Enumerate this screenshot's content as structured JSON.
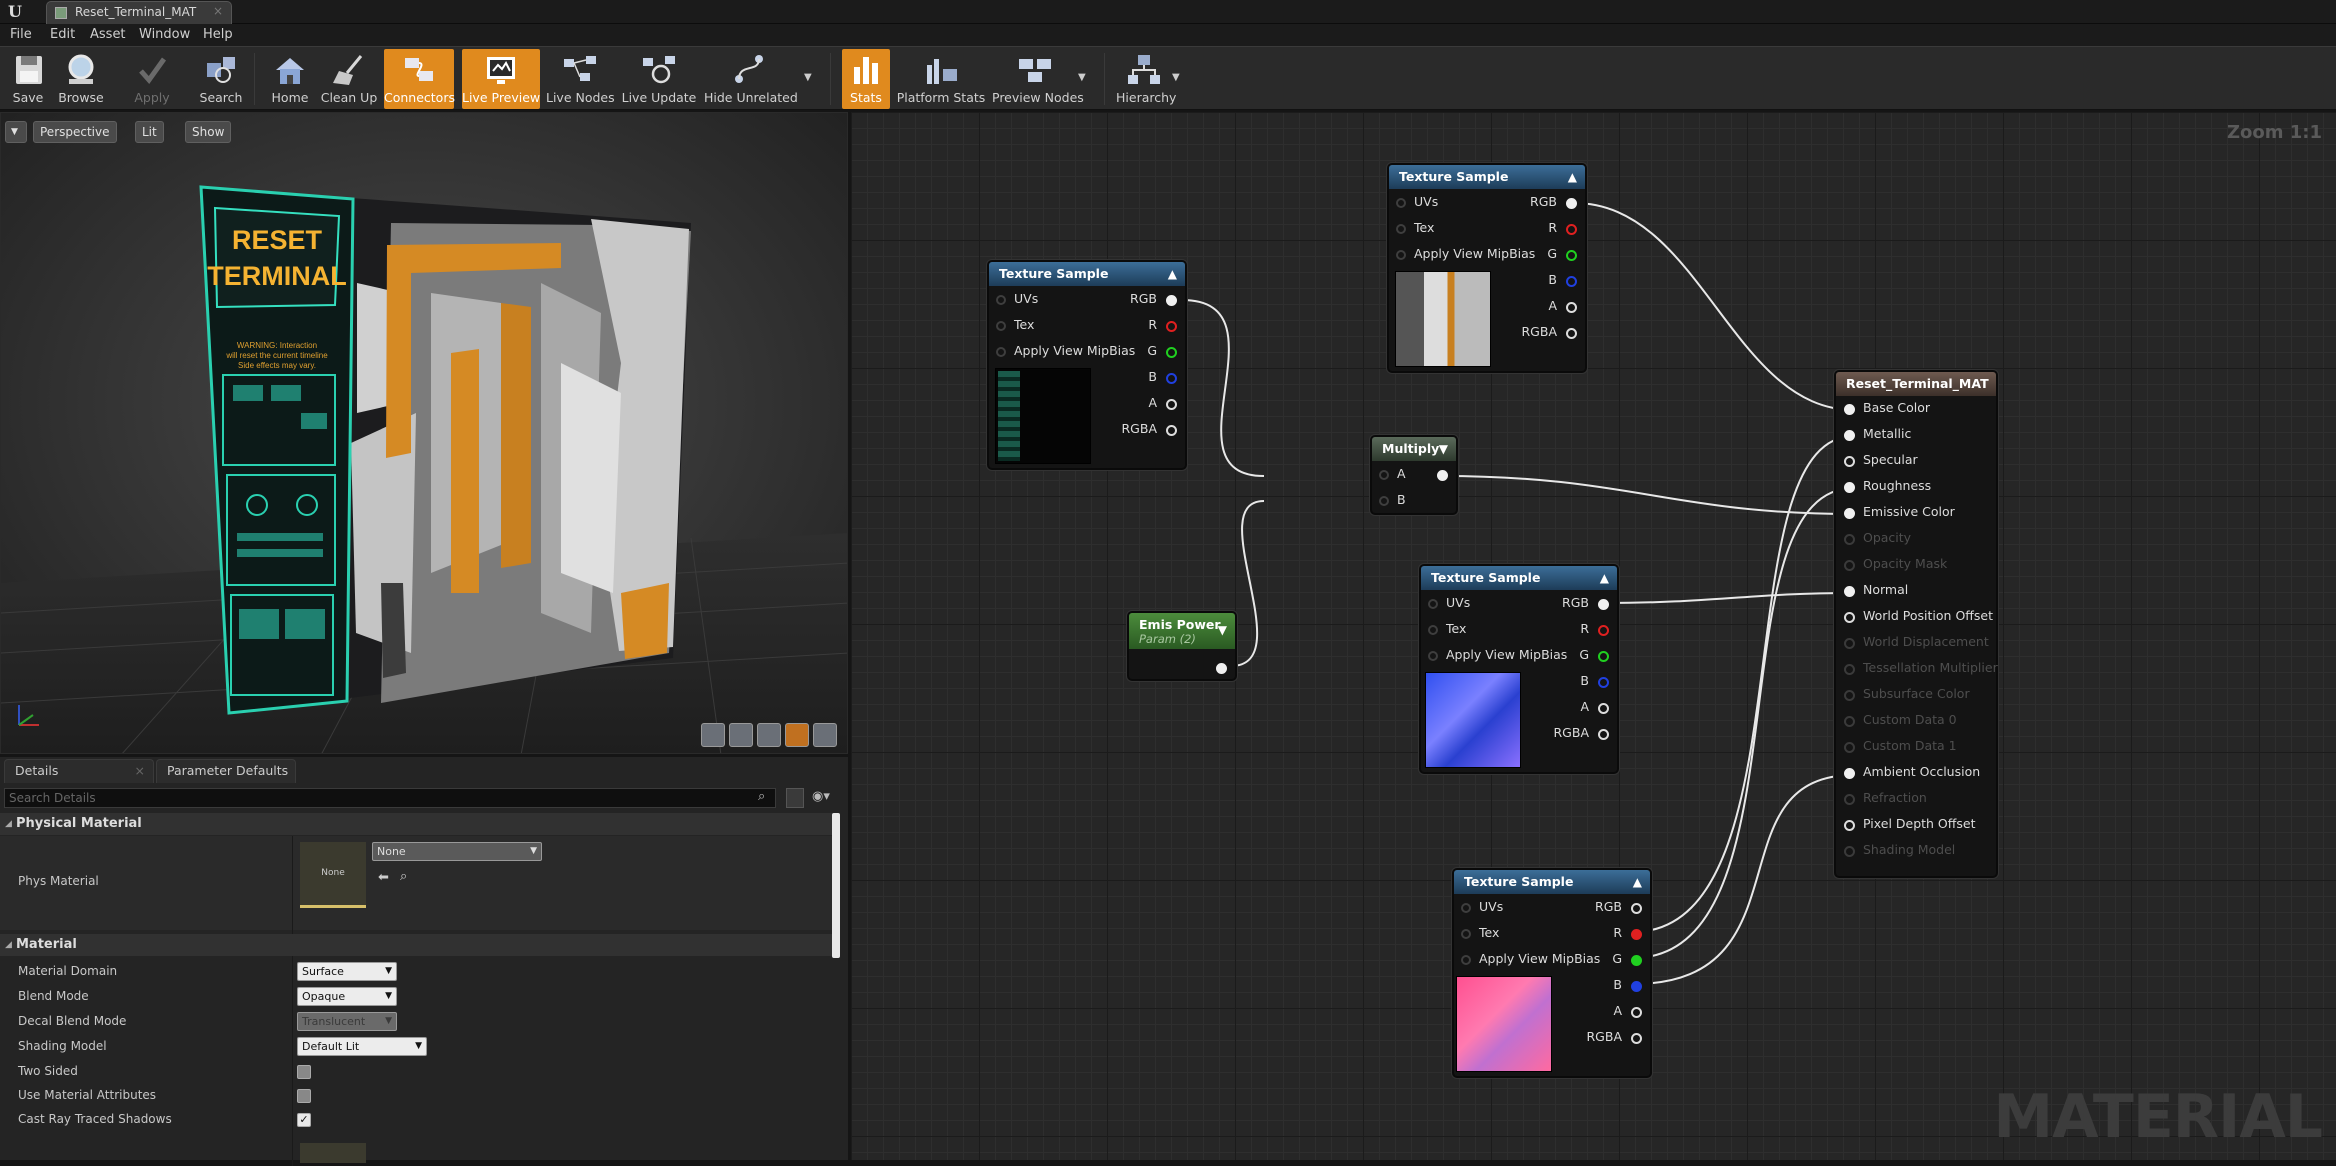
{
  "titlebar": {
    "tab_title": "Reset_Terminal_MAT",
    "close_glyph": "×"
  },
  "menu": [
    "File",
    "Edit",
    "Asset",
    "Window",
    "Help"
  ],
  "toolbar": {
    "save": "Save",
    "browse": "Browse",
    "apply": "Apply",
    "search": "Search",
    "home": "Home",
    "clean_up": "Clean Up",
    "connectors": "Connectors",
    "live_preview": "Live Preview",
    "live_nodes": "Live Nodes",
    "live_update": "Live Update",
    "hide_unrelated": "Hide Unrelated",
    "stats": "Stats",
    "platform_stats": "Platform Stats",
    "preview_nodes": "Preview Nodes",
    "hierarchy": "Hierarchy"
  },
  "viewport": {
    "perspective": "Perspective",
    "lit": "Lit",
    "show": "Show",
    "screen_title": "RESET\nTERMINAL",
    "screen_title_l1": "RESET",
    "screen_title_l2": "TERMINAL",
    "warning_l1": "WARNING: Interaction",
    "warning_l2": "will reset the current timeline",
    "warning_l3": "Side effects may vary."
  },
  "details": {
    "tab_details": "Details",
    "tab_params": "Parameter Defaults",
    "search_placeholder": "Search Details",
    "cat_physical": "Physical Material",
    "phys_material_label": "Phys Material",
    "phys_thumb": "None",
    "phys_value": "None",
    "cat_material": "Material",
    "rows": [
      {
        "label": "Material Domain",
        "value": "Surface"
      },
      {
        "label": "Blend Mode",
        "value": "Opaque"
      },
      {
        "label": "Decal Blend Mode",
        "value": "Translucent"
      },
      {
        "label": "Shading Model",
        "value": "Default Lit"
      },
      {
        "label": "Two Sided",
        "checked": false
      },
      {
        "label": "Use Material Attributes",
        "checked": false
      },
      {
        "label": "Cast Ray Traced Shadows",
        "checked": true
      }
    ]
  },
  "graph": {
    "zoom": "Zoom 1:1",
    "watermark": "MATERIAL",
    "node_texture_title": "Texture Sample",
    "node_multiply_title": "Multiply",
    "node_emis_title": "Emis Power",
    "node_emis_sub": "Param (2)",
    "texture_inputs": [
      "UVs",
      "Tex",
      "Apply View MipBias"
    ],
    "texture_outputs": [
      "RGB",
      "R",
      "G",
      "B",
      "A",
      "RGBA"
    ],
    "multiply_inputs": [
      "A",
      "B"
    ],
    "result_title": "Reset_Terminal_MAT",
    "result_pins": [
      {
        "label": "Base Color",
        "active": true
      },
      {
        "label": "Metallic",
        "active": true
      },
      {
        "label": "Specular",
        "active": true
      },
      {
        "label": "Roughness",
        "active": true
      },
      {
        "label": "Emissive Color",
        "active": true
      },
      {
        "label": "Opacity",
        "active": false
      },
      {
        "label": "Opacity Mask",
        "active": false
      },
      {
        "label": "Normal",
        "active": true
      },
      {
        "label": "World Position Offset",
        "active": true
      },
      {
        "label": "World Displacement",
        "active": false
      },
      {
        "label": "Tessellation Multiplier",
        "active": false
      },
      {
        "label": "Subsurface Color",
        "active": false
      },
      {
        "label": "Custom Data 0",
        "active": false
      },
      {
        "label": "Custom Data 1",
        "active": false
      },
      {
        "label": "Ambient Occlusion",
        "active": true
      },
      {
        "label": "Refraction",
        "active": false
      },
      {
        "label": "Pixel Depth Offset",
        "active": true
      },
      {
        "label": "Shading Model",
        "active": false
      }
    ]
  },
  "colors": {
    "accent": "#e08a1e",
    "pin_r": "#e02020",
    "pin_g": "#20d020",
    "pin_b": "#2040e0"
  }
}
